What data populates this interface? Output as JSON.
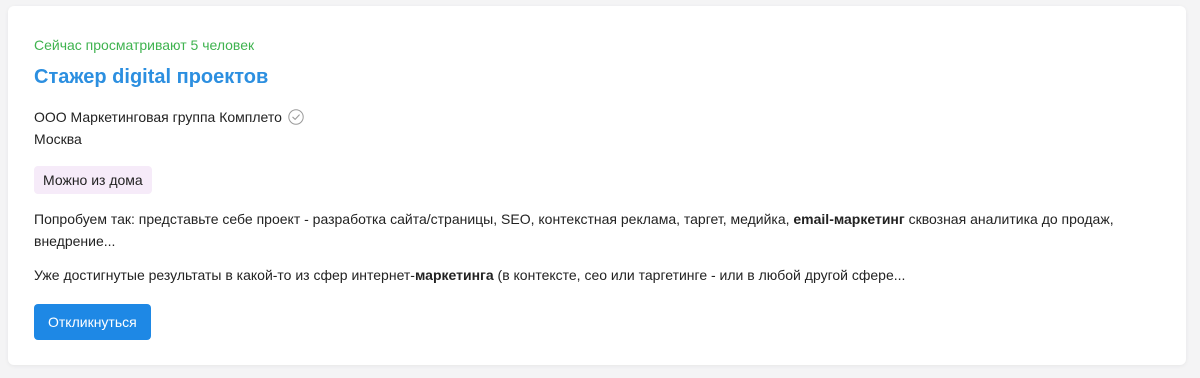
{
  "vacancy": {
    "viewers_text": "Сейчас просматривают 5 человек",
    "title": "Стажер digital проектов",
    "company": "ООО Маркетинговая группа Комплето",
    "company_verified_icon": "check-circle-icon",
    "city": "Москва",
    "tag": "Можно из дома",
    "description_1": {
      "part1": "Попробуем так: представьте себе проект - разработка сайта/страницы, SEO, контекстная реклама, таргет, медийка, ",
      "bold": "email-маркетинг",
      "part2": " сквозная аналитика до продаж, внедрение..."
    },
    "description_2": {
      "part1": "Уже достигнутые результаты в какой-то из сфер интернет-",
      "bold": "маркетинга",
      "part2": " (в контексте, сео или таргетинге - или в любой другой сфере..."
    },
    "respond_button": "Откликнуться"
  },
  "colors": {
    "viewers": "#3fb34f",
    "title": "#2c8fe0",
    "tag_bg": "#f6ebf9",
    "button_bg": "#1e88e5"
  }
}
